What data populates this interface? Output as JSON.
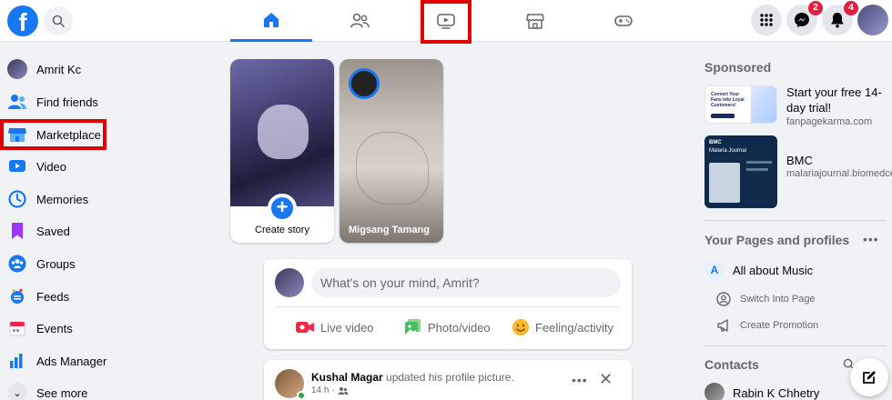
{
  "topbar": {
    "logo": "f",
    "tabs": [
      {
        "name": "home-icon",
        "active": true
      },
      {
        "name": "friends-icon",
        "active": false
      },
      {
        "name": "watch-icon",
        "active": false,
        "highlighted": true
      },
      {
        "name": "marketplace-icon",
        "active": false
      },
      {
        "name": "gaming-icon",
        "active": false
      }
    ],
    "messenger_badge": "2",
    "notifications_badge": "4"
  },
  "sidebar": {
    "items": [
      {
        "label": "Amrit Kc",
        "icon": "profile-avatar"
      },
      {
        "label": "Find friends",
        "icon": "friends-icon"
      },
      {
        "label": "Marketplace",
        "icon": "marketplace-icon",
        "highlighted": true
      },
      {
        "label": "Video",
        "icon": "video-icon"
      },
      {
        "label": "Memories",
        "icon": "memories-icon"
      },
      {
        "label": "Saved",
        "icon": "saved-icon"
      },
      {
        "label": "Groups",
        "icon": "groups-icon"
      },
      {
        "label": "Feeds",
        "icon": "feeds-icon"
      },
      {
        "label": "Events",
        "icon": "events-icon"
      },
      {
        "label": "Ads Manager",
        "icon": "ads-manager-icon"
      },
      {
        "label": "See more",
        "icon": "chevron-down-icon"
      }
    ]
  },
  "stories": {
    "create_label": "Create story",
    "friend_story_name": "Migsang Tamang"
  },
  "composer": {
    "placeholder": "What's on your mind, Amrit?",
    "actions": {
      "live": "Live video",
      "photo": "Photo/video",
      "feeling": "Feeling/activity"
    }
  },
  "post": {
    "author": "Kushal Magar",
    "action": " updated his profile picture.",
    "time": "14 h ·"
  },
  "right": {
    "sponsored_heading": "Sponsored",
    "ads": [
      {
        "title": "Start your free 14-day trial!",
        "url": "fanpagekarma.com",
        "thumb_text_1": "Convert Your Fans into Loyal Customers!"
      },
      {
        "title": "BMC",
        "url": "malariajournal.biomedcentral.com",
        "thumb_text_1": "BMC",
        "thumb_text_2": "Malaria Journal"
      }
    ],
    "pages_heading": "Your Pages and profiles",
    "page_name": "All about Music",
    "page_initial": "A",
    "switch_label": "Switch Into Page",
    "promotion_label": "Create Promotion",
    "contacts_heading": "Contacts",
    "contact_name": "Rabin K Chhetry"
  },
  "colors": {
    "brand": "#1877f2",
    "highlight": "#e10000",
    "badge": "#e41e3f"
  }
}
